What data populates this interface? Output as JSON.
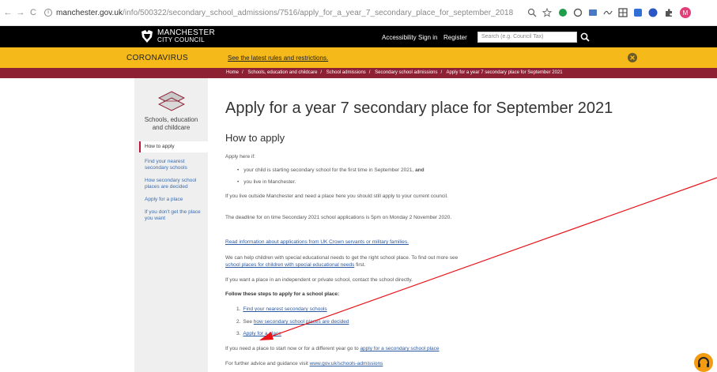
{
  "browser": {
    "url_host": "manchester.gov.uk",
    "url_path": "/info/500322/secondary_school_admissions/7516/apply_for_a_year_7_secondary_place_for_september_2018"
  },
  "header": {
    "logo_line1": "MANCHESTER",
    "logo_line2": "CITY COUNCIL",
    "links": [
      "Accessibility",
      "Sign in",
      "Register"
    ],
    "search_placeholder": "Search (e.g. Council Tax)"
  },
  "alert": {
    "label": "CORONAVIRUS",
    "link": "See the latest rules and restrictions."
  },
  "breadcrumb": [
    "Home",
    "Schools, education and childcare",
    "School admissions",
    "Secondary school admissions",
    "Apply for a year 7 secondary place for September 2021"
  ],
  "sidebar": {
    "section_line1": "Schools, education",
    "section_line2": "and childcare",
    "items": [
      {
        "label": "How to apply"
      },
      {
        "label": "Find your nearest secondary schools"
      },
      {
        "label": "How secondary school places are decided"
      },
      {
        "label": "Apply for a place"
      },
      {
        "label": "If you don't get the place you want"
      }
    ]
  },
  "main": {
    "title": "Apply for a year 7 secondary place for September 2021",
    "subtitle": "How to apply",
    "apply_here": "Apply here if:",
    "bullet1_text": "your child is starting secondary school for the first time in September 2021, ",
    "bullet1_bold": "and",
    "bullet2": "you live in Manchester.",
    "outside": "If you live outside Manchester and need a place here you should still apply to your current council.",
    "deadline": "The deadline for on time Secondary 2021 school applications is 5pm on Monday 2 November 2020.",
    "crown_link": "Read information about applications from UK Crown servants or military families.",
    "sen_text1": "We can help children with special educational needs to get the right school place. To find out more see ",
    "sen_link": "school places for children with special educational needs",
    "sen_text2": " first.",
    "private": "If you want a place in an independent or private school, contact the school directly.",
    "steps_title": "Follow these steps to apply for a school place:",
    "steps": [
      {
        "num": "1.",
        "pre": "",
        "link": "Find your nearest secondary schools"
      },
      {
        "num": "2.",
        "pre": "See ",
        "link": "how secondary school places are decided"
      },
      {
        "num": "3.",
        "pre": "",
        "link": "Apply for a place"
      }
    ],
    "now_text": "If you need a place to start now or for a different year go to ",
    "now_link": "apply for a secondary school place",
    "advice_text": "For further advice and guidance visit ",
    "advice_link": "www.gov.uk/schools-admissions"
  },
  "colors": {
    "header_bg": "#000000",
    "alert_bg": "#f6b91a",
    "breadcrumb_bg": "#8e2033",
    "link": "#2c5aa0",
    "annotation_arrow": "#e8141a"
  }
}
